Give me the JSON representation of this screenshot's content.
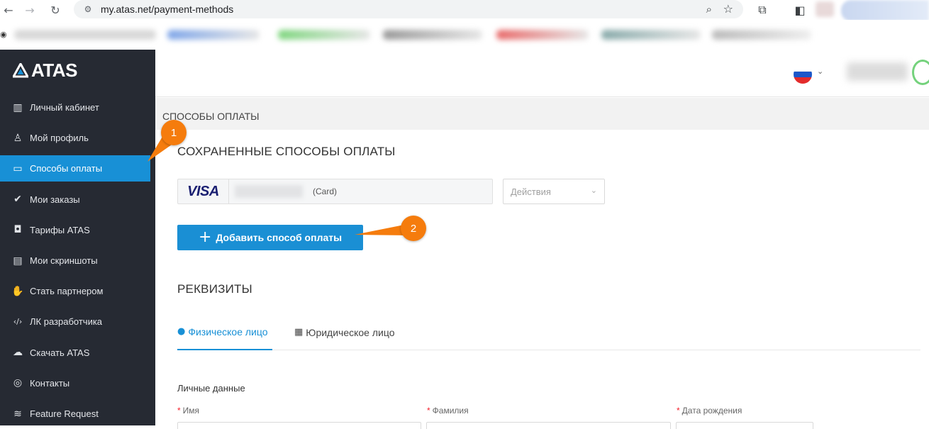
{
  "browser": {
    "url": "my.atas.net/payment-methods",
    "back_icon": "arrow-left-icon",
    "forward_icon": "arrow-right-icon",
    "reload_icon": "reload-icon"
  },
  "brand": {
    "name": "ATAS",
    "accent": "#1890d6",
    "sidebar_bg": "#262a33",
    "annotation_color": "#f57c0d"
  },
  "sidebar": {
    "items": [
      {
        "label": "Личный кабинет",
        "icon": "chart-bars-icon",
        "active": false
      },
      {
        "label": "Мой профиль",
        "icon": "user-icon",
        "active": false
      },
      {
        "label": "Способы оплаты",
        "icon": "credit-card-icon",
        "active": true
      },
      {
        "label": "Мои заказы",
        "icon": "checkmark-icon",
        "active": false
      },
      {
        "label": "Тарифы ATAS",
        "icon": "shopping-bag-icon",
        "active": false
      },
      {
        "label": "Мои скриншоты",
        "icon": "image-file-icon",
        "active": false
      },
      {
        "label": "Стать партнером",
        "icon": "handshake-icon",
        "active": false
      },
      {
        "label": "ЛК разработчика",
        "icon": "code-icon",
        "active": false
      },
      {
        "label": "Скачать ATAS",
        "icon": "cloud-download-icon",
        "active": false
      },
      {
        "label": "Контакты",
        "icon": "headset-icon",
        "active": false
      },
      {
        "label": "Feature Request",
        "icon": "layers-icon",
        "active": false
      }
    ]
  },
  "header": {
    "language": "ru"
  },
  "page": {
    "title": "СПОСОБЫ ОПЛАТЫ",
    "saved_methods_title": "СОХРАНЕННЫЕ СПОСОБЫ ОПЛАТЫ",
    "card": {
      "brand": "VISA",
      "type_label": "(Card)"
    },
    "actions_placeholder": "Действия",
    "add_button_label": "Добавить способ оплаты",
    "requisites_title": "РЕКВИЗИТЫ",
    "tabs": [
      {
        "label": "Физическое лицо",
        "icon": "person-icon",
        "active": true
      },
      {
        "label": "Юридическое лицо",
        "icon": "building-icon",
        "active": false
      }
    ],
    "personal_data_title": "Личные данные",
    "fields": [
      {
        "label": "Имя",
        "required": true
      },
      {
        "label": "Фамилия",
        "required": true
      },
      {
        "label": "Дата рождения",
        "required": true
      }
    ]
  },
  "annotations": [
    {
      "number": "1"
    },
    {
      "number": "2"
    }
  ]
}
